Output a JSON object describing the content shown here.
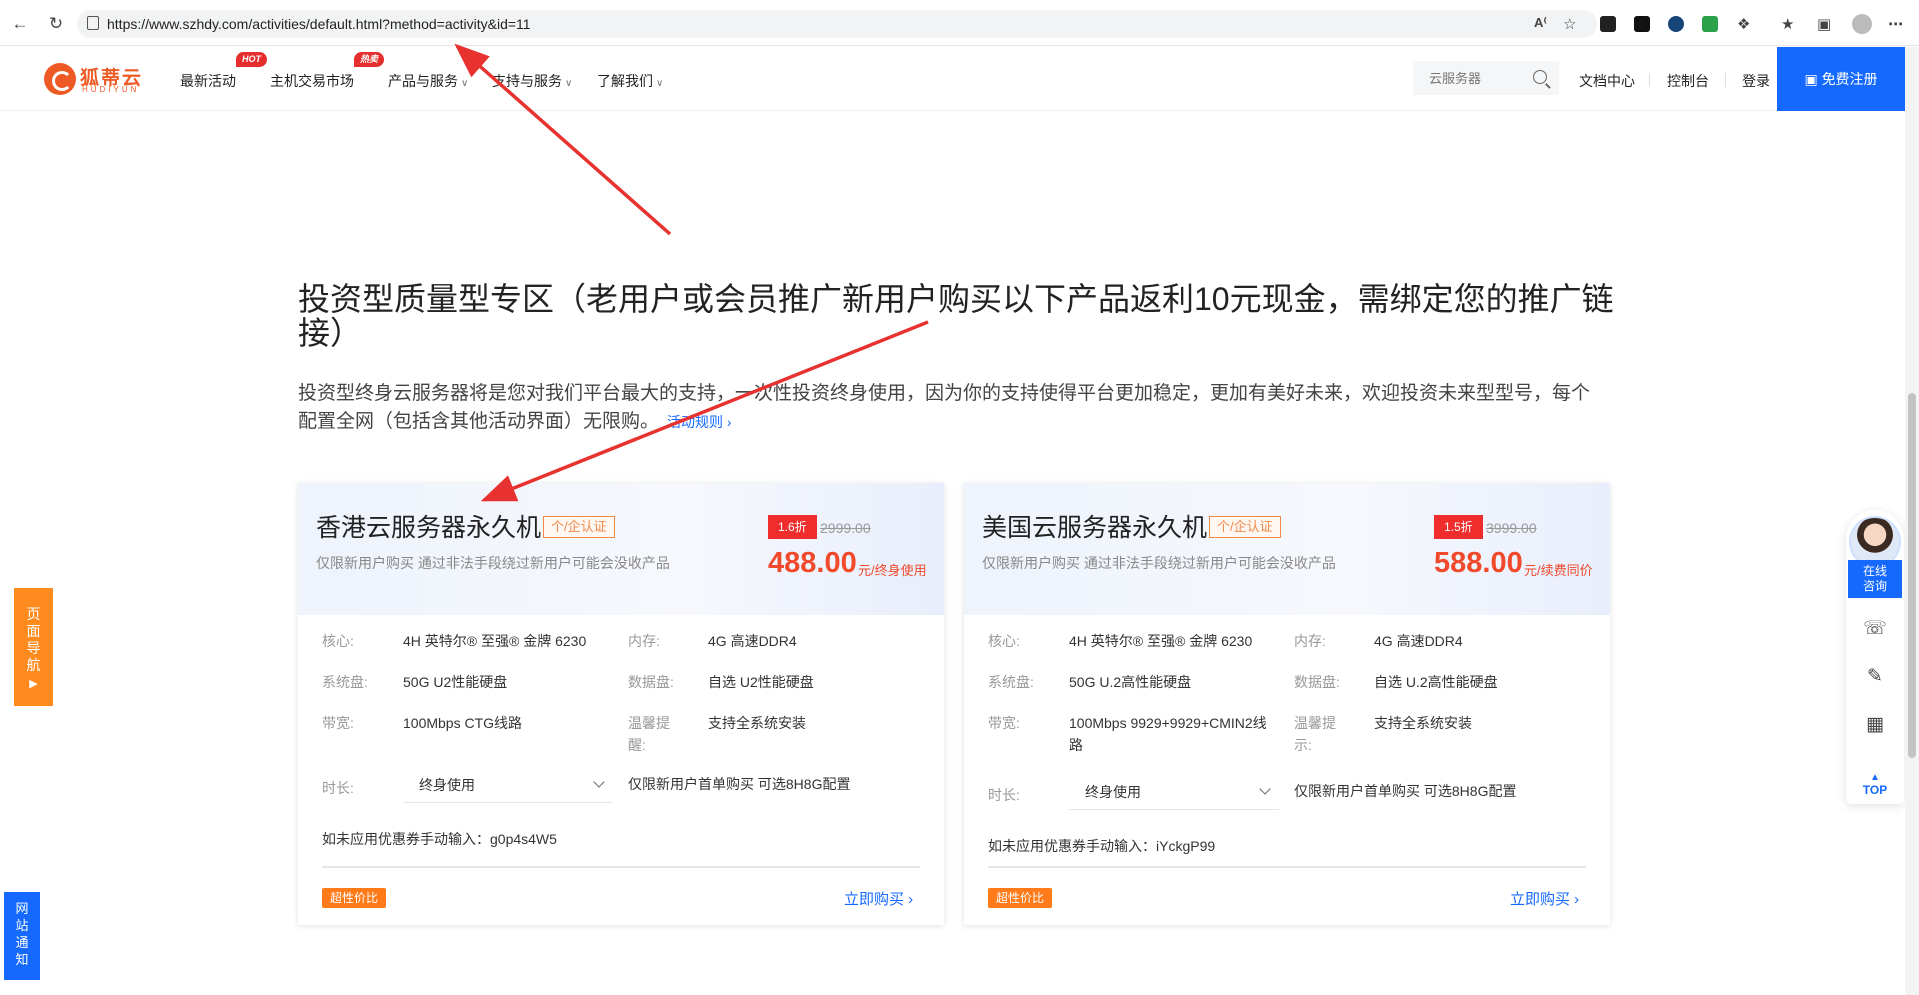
{
  "browser": {
    "url": "https://www.szhdy.com/activities/default.html?method=activity&id=11"
  },
  "header": {
    "logo_text": "狐蒂云",
    "logo_sub": "HUDIYUN",
    "nav": [
      {
        "label": "最新活动"
      },
      {
        "label": "主机交易市场",
        "badge": "HOT"
      },
      {
        "label": "产品与服务",
        "badge": "热卖"
      },
      {
        "label": "支持与服务"
      },
      {
        "label": "了解我们"
      }
    ],
    "search_placeholder": "云服务器",
    "links": [
      "文档中心",
      "控制台",
      "登录"
    ],
    "register": "免费注册"
  },
  "promo": {
    "title": "投资型质量型专区（老用户或会员推广新用户购买以下产品返利10元现金，需绑定您的推广链接）",
    "desc": "投资型终身云服务器将是您对我们平台最大的支持，一次性投资终身使用，因为你的支持使得平台更加稳定，更加有美好未来，欢迎投资未来型型号，每个配置全网（包括含其他活动界面）无限购。",
    "rules_link": "活动规则"
  },
  "products": [
    {
      "title": "香港云服务器永久机",
      "cert": "个/企认证",
      "subtitle": "仅限新用户购买 通过非法手段绕过新用户可能会没收产品",
      "discount": "1.6折",
      "orig_price": "2999.00",
      "price": "488.00",
      "price_unit": "元/终身使用",
      "specs": {
        "core_label": "核心:",
        "core": "4H 英特尔® 至强® 金牌 6230",
        "mem_label": "内存:",
        "mem": "4G 高速DDR4",
        "sysdisk_label": "系统盘:",
        "sysdisk": "50G U2性能硬盘",
        "datadisk_label": "数据盘:",
        "datadisk": "自选 U2性能硬盘",
        "bw_label": "带宽:",
        "bw": "100Mbps CTG线路",
        "tip_label": "温馨提醒:",
        "tip": "支持全系统安装"
      },
      "duration_label": "时长:",
      "duration": "终身使用",
      "note": "仅限新用户首单购买 可选8H8G配置",
      "coupon": "如未应用优惠券手动输入：g0p4s4W5",
      "value_tag": "超性价比",
      "buy": "立即购买"
    },
    {
      "title": "美国云服务器永久机",
      "cert": "个/企认证",
      "subtitle": "仅限新用户购买 通过非法手段绕过新用户可能会没收产品",
      "discount": "1.5折",
      "orig_price": "3999.00",
      "price": "588.00",
      "price_unit": "元/续费同价",
      "specs": {
        "core_label": "核心:",
        "core": "4H 英特尔® 至强® 金牌 6230",
        "mem_label": "内存:",
        "mem": "4G 高速DDR4",
        "sysdisk_label": "系统盘:",
        "sysdisk": "50G U.2高性能硬盘",
        "datadisk_label": "数据盘:",
        "datadisk": "自选 U.2高性能硬盘",
        "bw_label": "带宽:",
        "bw": "100Mbps 9929+9929+CMIN2线路",
        "tip_label": "温馨提示:",
        "tip": "支持全系统安装"
      },
      "duration_label": "时长:",
      "duration": "终身使用",
      "note": "仅限新用户首单购买 可选8H8G配置",
      "coupon": "如未应用优惠券手动输入：iYckgP99",
      "value_tag": "超性价比",
      "buy": "立即购买"
    }
  ],
  "side": {
    "page_nav": "页面导航",
    "site_notice": "网站通知",
    "chat": "在线咨询",
    "top": "TOP"
  },
  "colors": {
    "brand": "#1669ff",
    "price": "#f0492b",
    "accent_orange": "#ff8a1e",
    "annotation": "#e8322f"
  }
}
